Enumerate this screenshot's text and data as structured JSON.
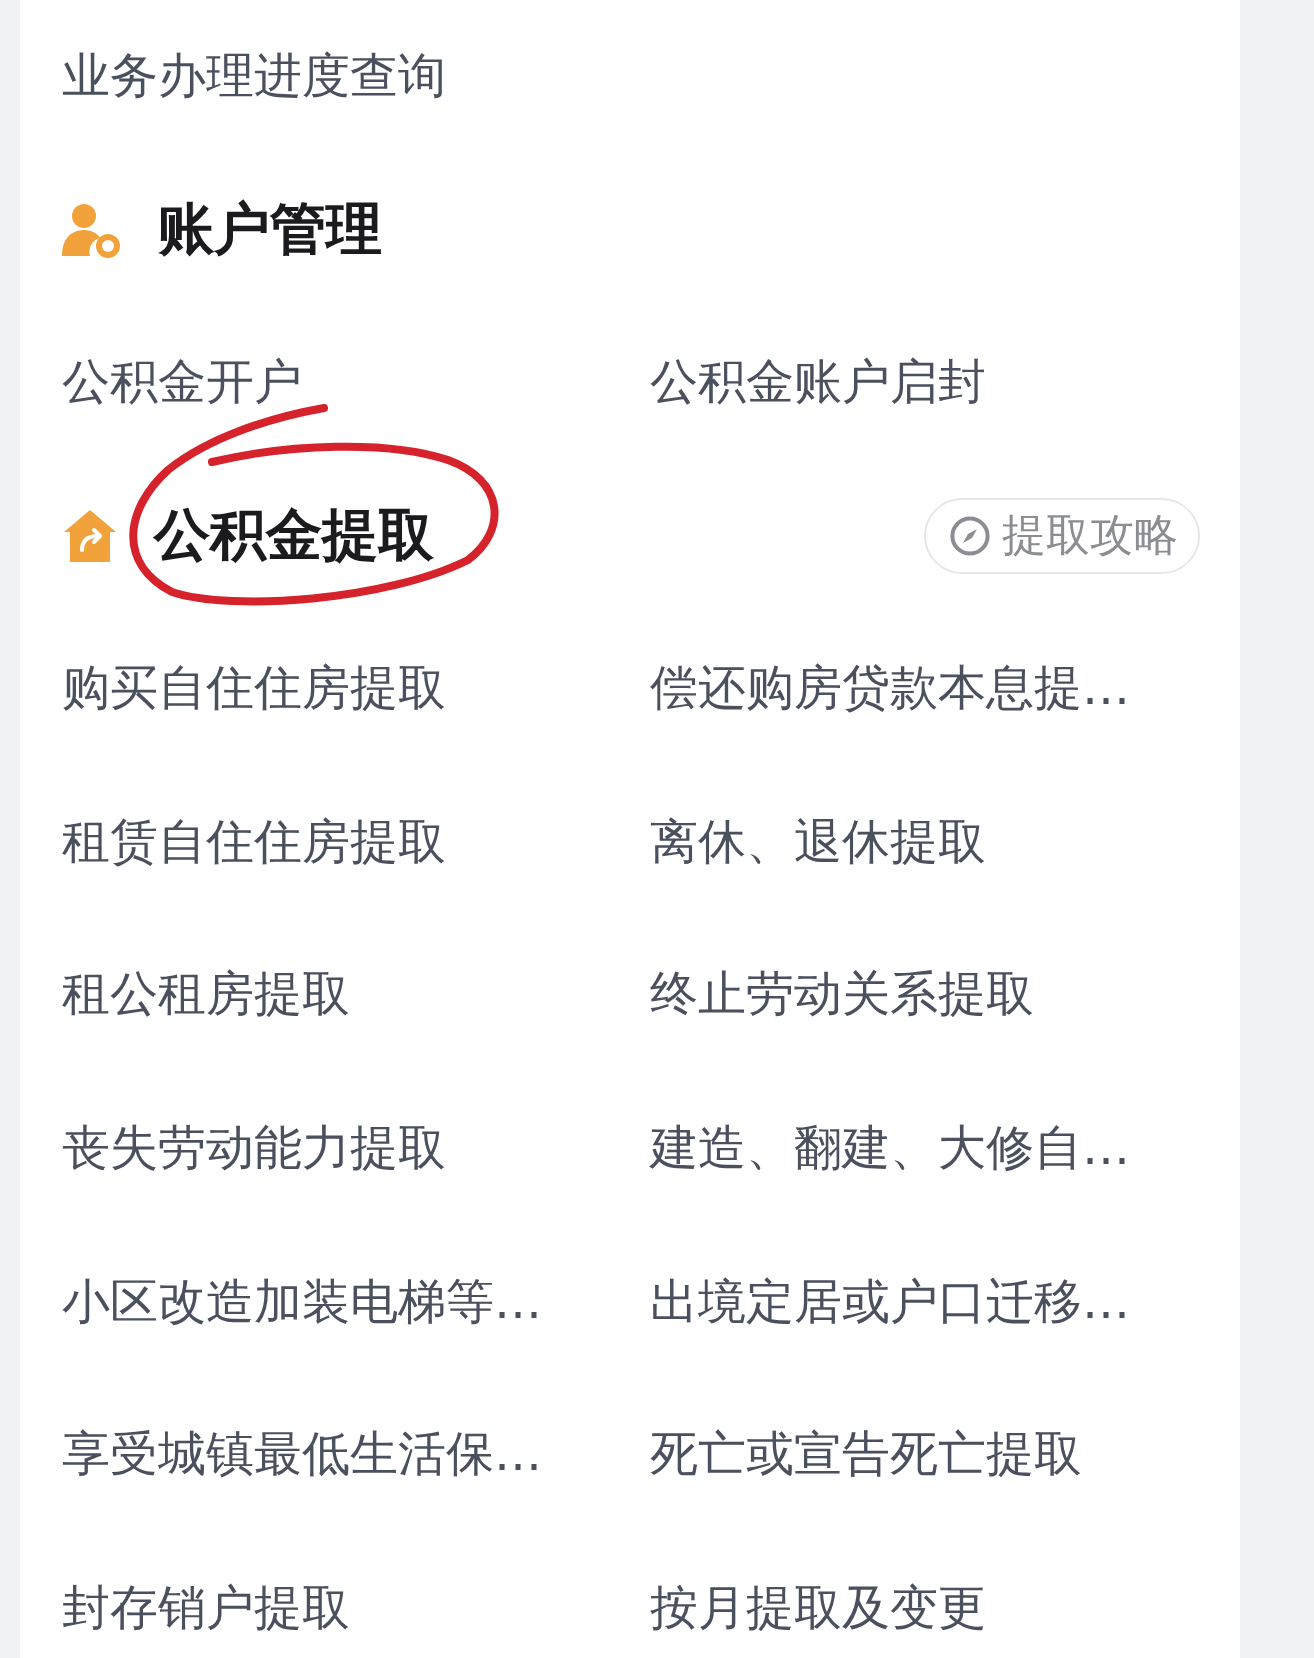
{
  "top_link": {
    "label": "业务办理进度查询"
  },
  "sections": [
    {
      "kind": "account",
      "title": "账户管理",
      "circled": false,
      "items": [
        "公积金开户",
        "公积金账户启封"
      ]
    },
    {
      "kind": "withdrawal",
      "title": "公积金提取",
      "circled": true,
      "guide_button": {
        "label": "提取攻略"
      },
      "items": [
        "购买自住住房提取",
        "偿还购房贷款本息提…",
        "租赁自住住房提取",
        "离休、退休提取",
        "租公租房提取",
        "终止劳动关系提取",
        "丧失劳动能力提取",
        "建造、翻建、大修自…",
        "小区改造加装电梯等…",
        "出境定居或户口迁移…",
        "享受城镇最低生活保…",
        "死亡或宣告死亡提取",
        "封存销户提取",
        "按月提取及变更"
      ]
    }
  ]
}
